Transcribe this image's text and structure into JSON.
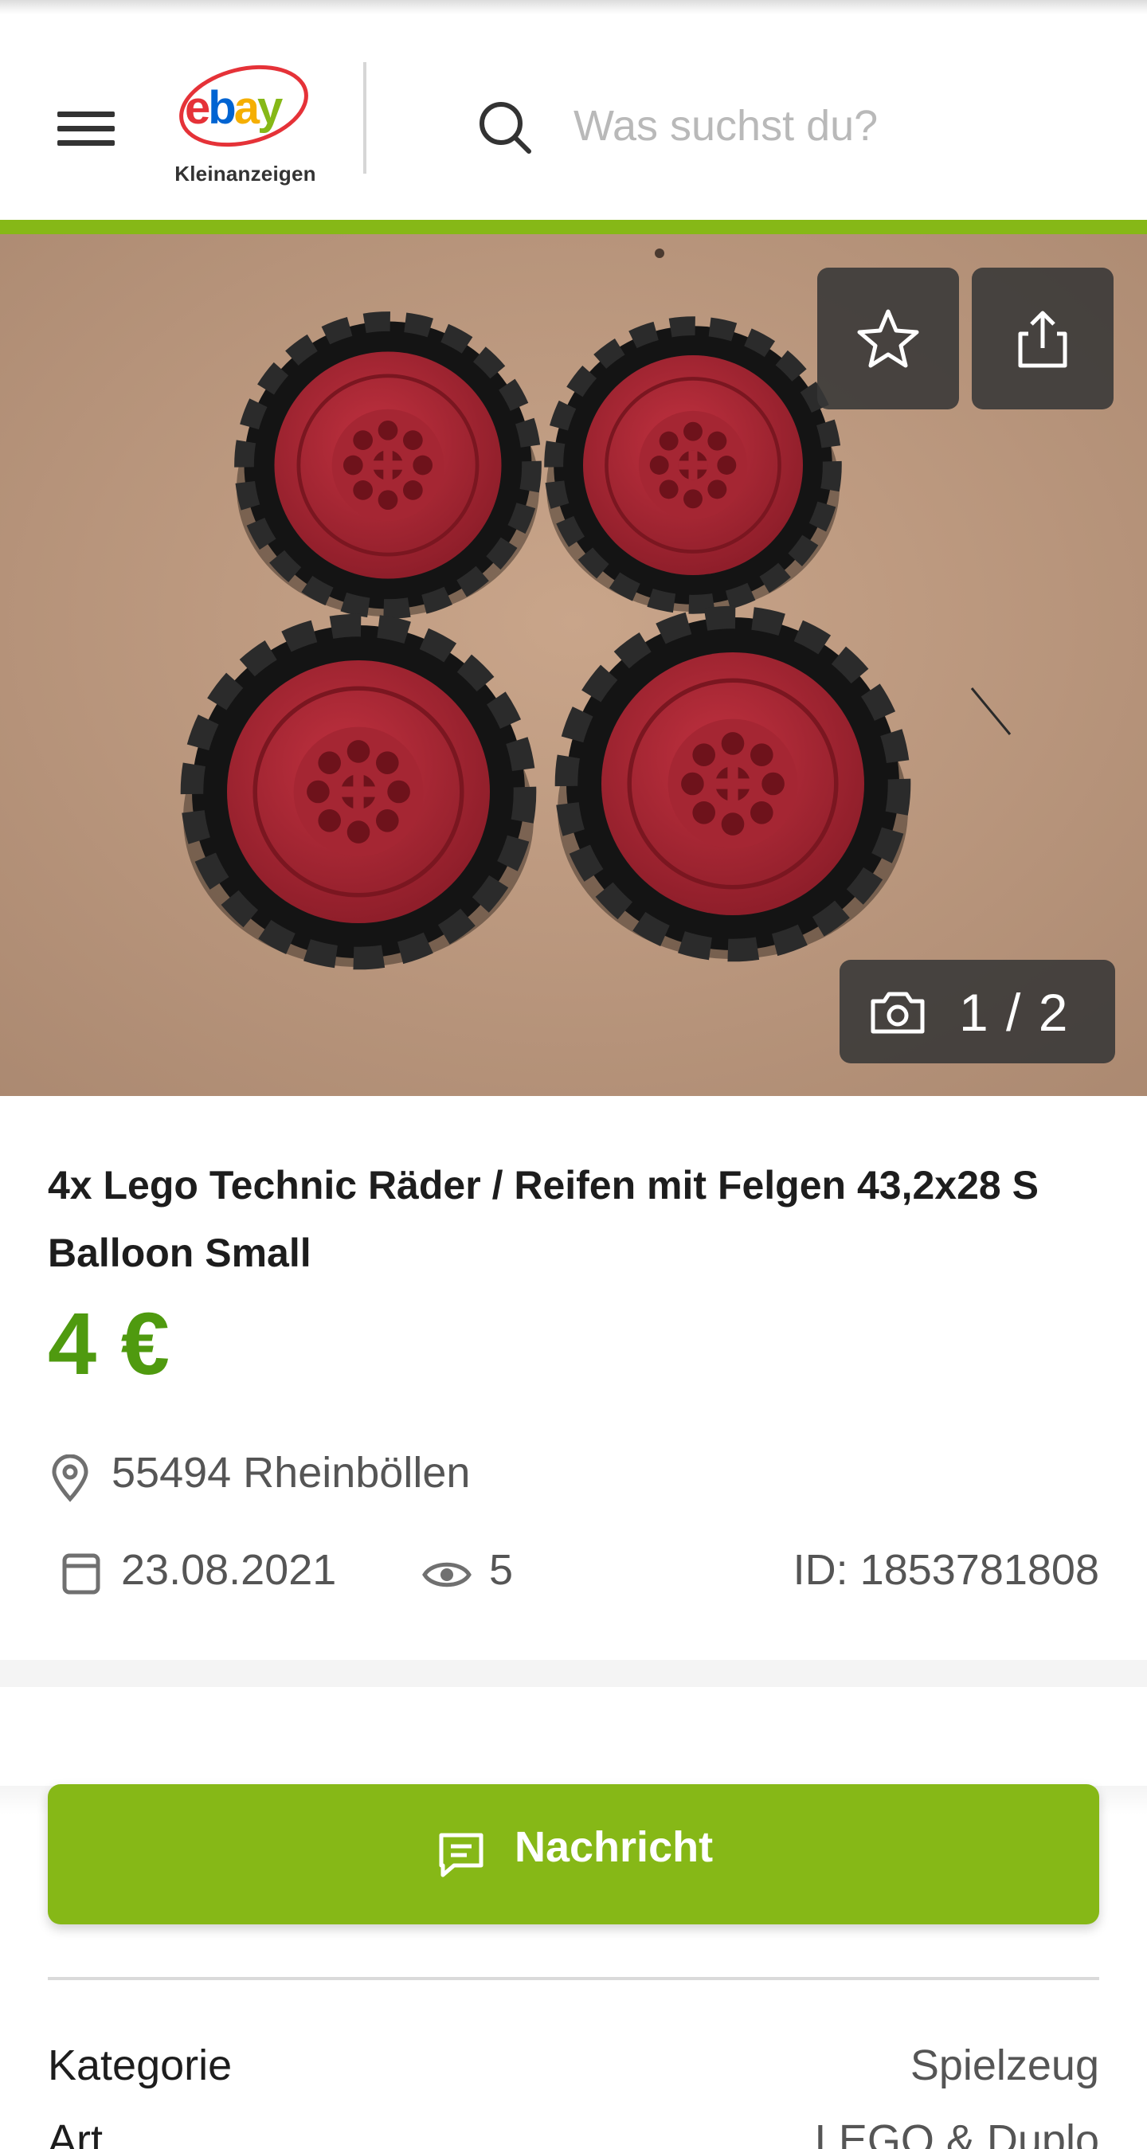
{
  "header": {
    "logo_text": "ebay",
    "logo_sub": "Kleinanzeigen",
    "search_placeholder": "Was suchst du?"
  },
  "gallery": {
    "counter": "1 / 2",
    "current": 1,
    "total": 2
  },
  "listing": {
    "title": "4x Lego Technic Räder / Reifen mit Felgen 43,2x28 S Balloon Small",
    "price": "4 €",
    "location": "55494 Rheinböllen",
    "date": "23.08.2021",
    "views": "5",
    "ad_id": "ID: 1853781808"
  },
  "actions": {
    "message_label": "Nachricht"
  },
  "attributes": [
    {
      "key": "Kategorie",
      "value": "Spielzeug"
    },
    {
      "key": "Art",
      "value": "LEGO & Duplo"
    }
  ],
  "icons": {
    "menu": "hamburger-icon",
    "search": "search-icon",
    "favorite": "star-icon",
    "share": "share-icon",
    "camera": "camera-icon",
    "location": "location-pin-icon",
    "date": "calendar-icon",
    "views": "eye-icon",
    "message": "chat-bubble-icon"
  },
  "colors": {
    "accent_green": "#86b817",
    "price_green": "#4f9a0f",
    "overlay": "#373737"
  }
}
